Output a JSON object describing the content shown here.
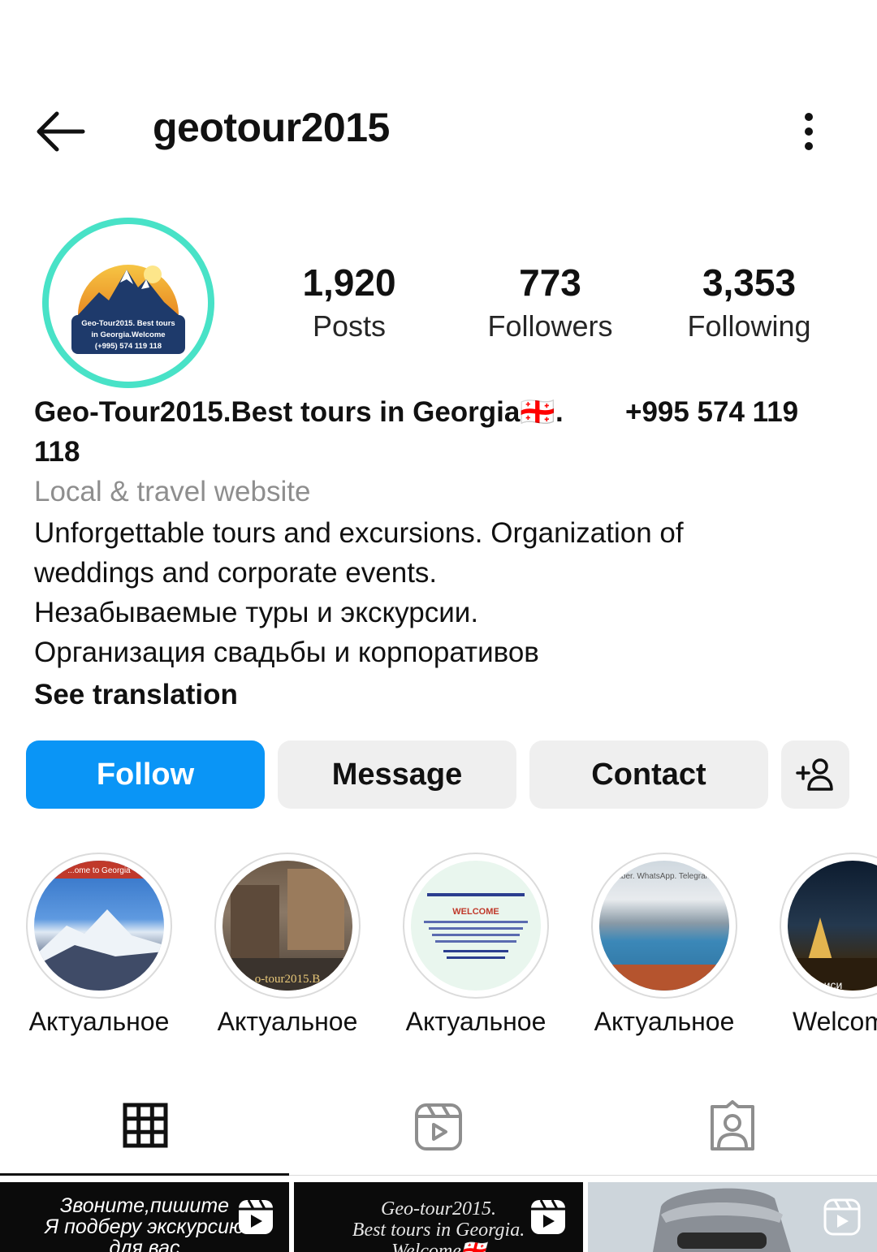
{
  "header": {
    "username": "geotour2015"
  },
  "avatar": {
    "logo_lines": [
      "Geo-Tour2015. Best tours",
      "in Georgia.Welcome",
      "(+995) 574 119 118"
    ]
  },
  "stats": [
    {
      "value": "1,920",
      "label": "Posts"
    },
    {
      "value": "773",
      "label": "Followers"
    },
    {
      "value": "3,353",
      "label": "Following"
    }
  ],
  "bio": {
    "name": "Geo-Tour2015.Best tours in Georgia🇬🇪.",
    "phone": "+995 574 119",
    "name_cont": "118",
    "category": "Local & travel website",
    "lines": [
      "Unforgettable tours and excursions.  Organization of",
      "weddings and corporate events.",
      "Незабываемые туры и экскурсии.",
      "Организация свадьбы и корпоративов"
    ],
    "see_translation": "See translation"
  },
  "buttons": {
    "follow": "Follow",
    "message": "Message",
    "contact": "Contact"
  },
  "highlights": [
    {
      "caption": "Актуальное",
      "overlay": "...ome to Georgia"
    },
    {
      "caption": "Актуальное",
      "overlay": "o-tour2015.B"
    },
    {
      "caption": "Актуальное",
      "overlay": "WELCOME"
    },
    {
      "caption": "Актуальное",
      "overlay": "Viber. WhatsApp. Telegram."
    },
    {
      "caption": "Welcom",
      "overlay": "иси"
    }
  ],
  "thumbnails": [
    {
      "lines": [
        "Звоните,пишите",
        "Я подберу экскурсию",
        "для вас"
      ]
    },
    {
      "lines": [
        "Geo-tour2015.",
        "Best tours in Georgia.",
        "Welcome🇬🇪"
      ]
    },
    {
      "lines": []
    }
  ],
  "colors": {
    "follow_button": "#0a95f6",
    "secondary_button": "#efefef",
    "avatar_ring": "#48e2c7",
    "muted_text": "#8e8e8e"
  }
}
